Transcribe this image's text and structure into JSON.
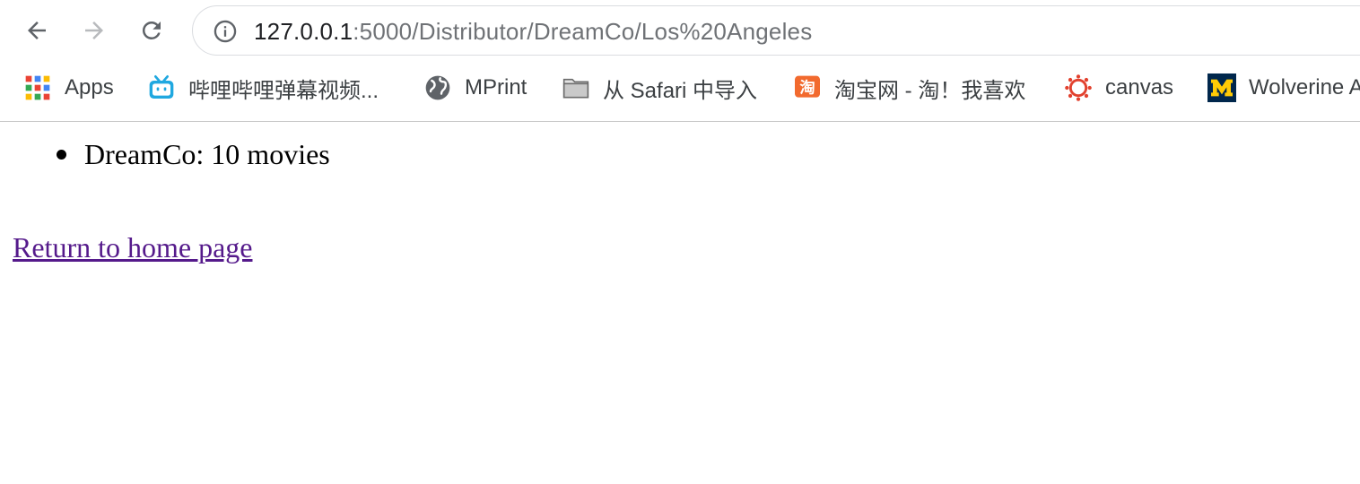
{
  "browser": {
    "back_icon": "arrow-left-icon",
    "forward_icon": "arrow-right-icon",
    "reload_icon": "reload-icon",
    "address": {
      "host": "127.0.0.1",
      "path": ":5000/Distributor/DreamCo/Los%20Angeles"
    },
    "bookmarks": [
      {
        "label": "Apps",
        "icon": "apps-grid-icon"
      },
      {
        "label": "哔哩哔哩弹幕视频...",
        "icon": "bilibili-tv-icon"
      },
      {
        "label": "MPrint",
        "icon": "globe-icon"
      },
      {
        "label": "从 Safari 中导入",
        "icon": "folder-icon"
      },
      {
        "label": "淘宝网 - 淘！我喜欢",
        "icon": "taobao-icon"
      },
      {
        "label": "canvas",
        "icon": "canvas-icon"
      },
      {
        "label": "Wolverine Access",
        "icon": "michigan-m-icon"
      }
    ]
  },
  "page": {
    "items": [
      "DreamCo: 10 movies"
    ],
    "home_link": "Return to home page"
  },
  "colors": {
    "link_visited": "#551a8b",
    "toolbar_icon": "#5f6368",
    "url_path": "#6f7276"
  }
}
